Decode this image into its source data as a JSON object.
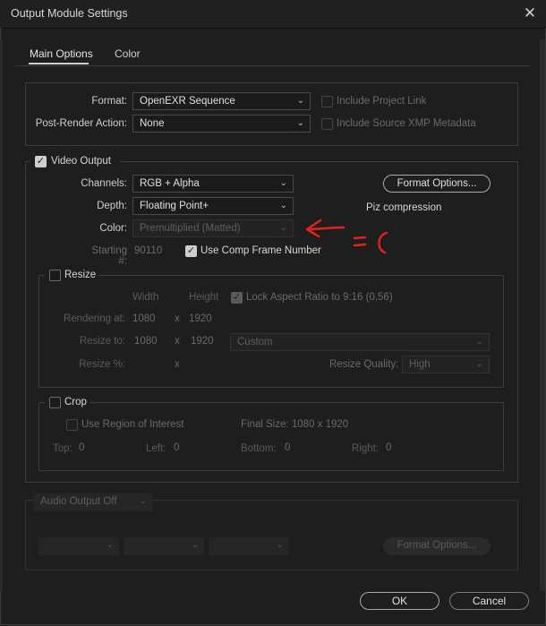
{
  "window": {
    "title": "Output Module Settings"
  },
  "tabs": [
    {
      "label": "Main Options"
    },
    {
      "label": "Color"
    }
  ],
  "format_group": {
    "format_label": "Format:",
    "format_value": "OpenEXR Sequence",
    "post_render_label": "Post-Render Action:",
    "post_render_value": "None",
    "include_project_link": "Include Project Link",
    "include_xmp": "Include Source XMP Metadata"
  },
  "video_output": {
    "label": "Video Output",
    "checked": true,
    "channels_label": "Channels:",
    "channels_value": "RGB + Alpha",
    "depth_label": "Depth:",
    "depth_value": "Floating Point+",
    "color_label": "Color:",
    "color_value": "Premultiplied (Matted)",
    "starting_label": "Starting #:",
    "starting_value": "90110",
    "use_comp_frame": "Use Comp Frame Number",
    "format_options": "Format Options...",
    "compression_note": "Piz compression"
  },
  "annotation": {
    "text": "=(",
    "color": "#e0241b"
  },
  "resize": {
    "label": "Resize",
    "width_header": "Width",
    "height_header": "Height",
    "lock_aspect": "Lock Aspect Ratio to 9:16 (0,56)",
    "rendering_at_label": "Rendering at:",
    "rendering_w": "1080",
    "rendering_h": "1920",
    "resize_to_label": "Resize to:",
    "resize_to_w": "1080",
    "resize_to_h": "1920",
    "resize_to_preset": "Custom",
    "resize_pct_label": "Resize %:",
    "x": "x",
    "quality_label": "Resize Quality:",
    "quality_value": "High"
  },
  "crop": {
    "label": "Crop",
    "use_roi": "Use Region of Interest",
    "final_size": "Final Size: 1080 x 1920",
    "top_label": "Top:",
    "top_value": "0",
    "left_label": "Left:",
    "left_value": "0",
    "bottom_label": "Bottom:",
    "bottom_value": "0",
    "right_label": "Right:",
    "right_value": "0"
  },
  "audio": {
    "output_value": "Audio Output Off",
    "format_options": "Format Options..."
  },
  "footer": {
    "ok": "OK",
    "cancel": "Cancel"
  }
}
